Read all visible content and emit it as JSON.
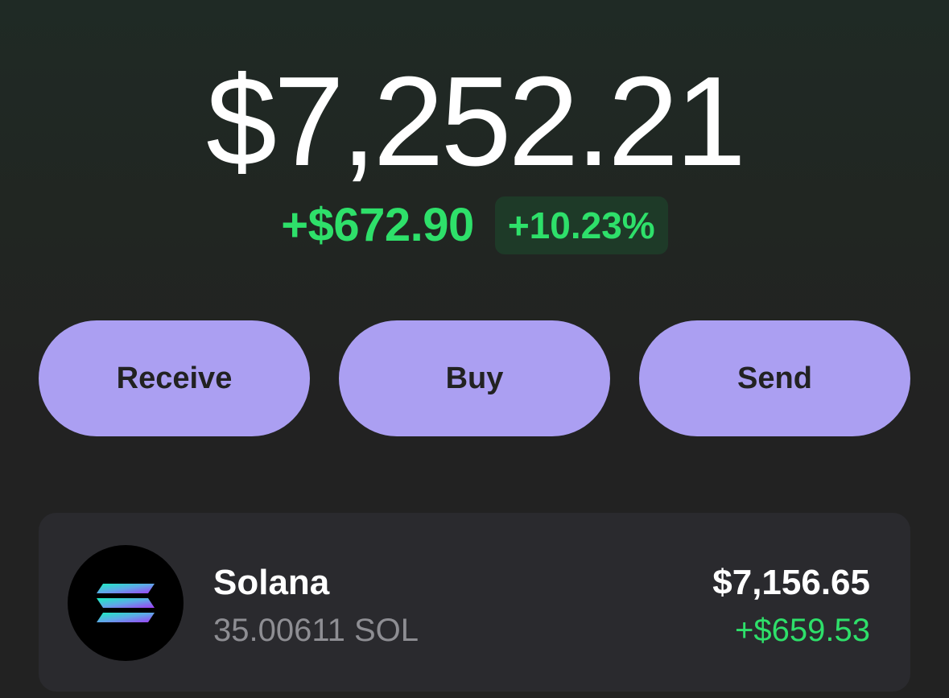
{
  "balance": {
    "total": "$7,252.21",
    "change_amount": "+$672.90",
    "change_percent": "+10.23%"
  },
  "actions": {
    "receive_label": "Receive",
    "buy_label": "Buy",
    "send_label": "Send"
  },
  "tokens": [
    {
      "name": "Solana",
      "amount": "35.00611 SOL",
      "value": "$7,156.65",
      "change": "+$659.53",
      "icon": "solana-logo-icon"
    }
  ],
  "colors": {
    "accent": "#ab9ff2",
    "positive": "#2ee06a",
    "positive_bg": "#1e3a28",
    "card_bg": "#2a2a2e",
    "muted_text": "#8e8e93"
  }
}
